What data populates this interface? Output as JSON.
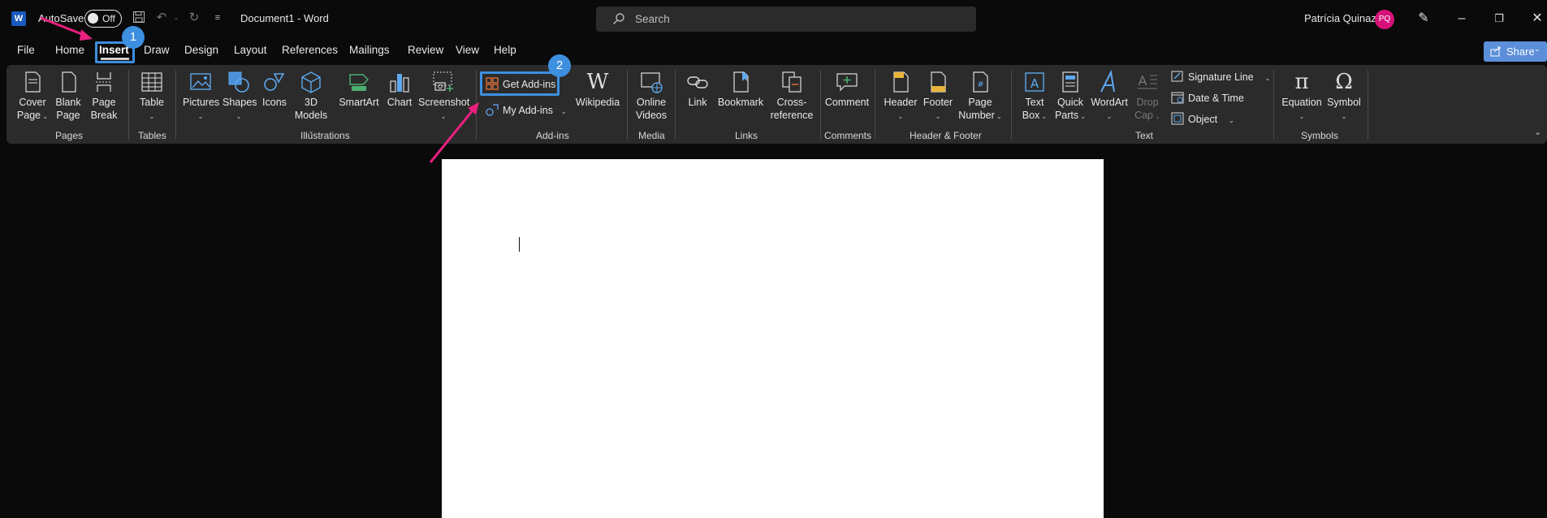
{
  "titlebar": {
    "app_icon": "word-icon",
    "app_letter": "W",
    "autosave_label": "AutoSave",
    "autosave_state": "Off",
    "doc_title": "Document1 - Word",
    "search_placeholder": "Search",
    "user_name": "Patrícia Quinaz",
    "user_initials": "PQ"
  },
  "tabs": [
    "File",
    "Home",
    "Insert",
    "Draw",
    "Design",
    "Layout",
    "References",
    "Mailings",
    "Review",
    "View",
    "Help"
  ],
  "active_tab": "Insert",
  "share_label": "Share",
  "ribbon": {
    "pages": {
      "cover": [
        "Cover",
        "Page"
      ],
      "blank": [
        "Blank",
        "Page"
      ],
      "break": [
        "Page",
        "Break"
      ],
      "group": "Pages"
    },
    "tables": {
      "table": "Table",
      "group": "Tables"
    },
    "illustrations": {
      "pictures": "Pictures",
      "shapes": "Shapes",
      "icons": "Icons",
      "models": [
        "3D",
        "Models"
      ],
      "smartart": "SmartArt",
      "chart": "Chart",
      "screenshot": "Screenshot",
      "group": "Illustrations"
    },
    "addins": {
      "get": "Get Add-ins",
      "my": "My Add-ins",
      "wikipedia": "Wikipedia",
      "group": "Add-ins"
    },
    "media": {
      "online_videos": [
        "Online",
        "Videos"
      ],
      "group": "Media"
    },
    "links": {
      "link": "Link",
      "bookmark": "Bookmark",
      "crossref": [
        "Cross-",
        "reference"
      ],
      "group": "Links"
    },
    "comments": {
      "comment": "Comment",
      "group": "Comments"
    },
    "header_footer": {
      "header": "Header",
      "footer": "Footer",
      "page_number": [
        "Page",
        "Number"
      ],
      "group": "Header & Footer"
    },
    "text": {
      "text_box": [
        "Text",
        "Box"
      ],
      "quick_parts": [
        "Quick",
        "Parts"
      ],
      "wordart": "WordArt",
      "drop_cap": [
        "Drop",
        "Cap"
      ],
      "signature_line": "Signature Line",
      "date_time": "Date & Time",
      "object": "Object",
      "group": "Text"
    },
    "symbols": {
      "equation": "Equation",
      "symbol": "Symbol",
      "group": "Symbols"
    }
  },
  "callouts": {
    "step1": "1",
    "step2": "2"
  },
  "colors": {
    "accent": "#3d8fe0",
    "arrow": "#e8207e",
    "avatar": "#d6117a"
  }
}
